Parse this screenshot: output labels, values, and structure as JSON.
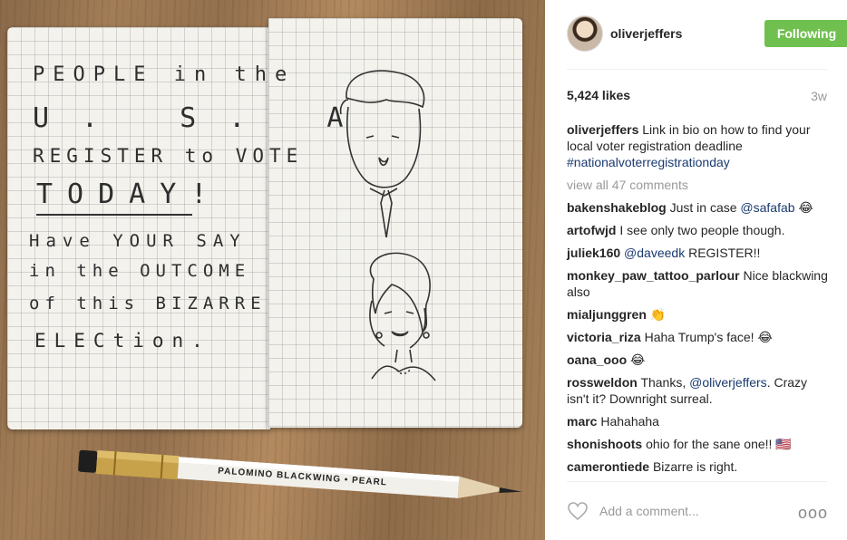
{
  "photo": {
    "notebook_text": [
      "PEOPLE in the",
      "U. S. A",
      "REGISTER to VOTE",
      "TODAY!",
      "Have YOUR SAY",
      "in the OUTCOME",
      "of this BIZARRE",
      "ELECtion."
    ],
    "pencil_text": "PALOMINO BLACKWING • PEARL"
  },
  "header": {
    "username": "oliverjeffers",
    "follow_label": "Following"
  },
  "post": {
    "likes": "5,424 likes",
    "age": "3w"
  },
  "caption": {
    "user": "oliverjeffers",
    "text": "Link in bio on how to find your local voter registration deadline",
    "hashtag": "#nationalvoterregistrationday"
  },
  "view_all": "view all 47 comments",
  "comments": [
    {
      "user": "bakenshakeblog",
      "text": "Just in case",
      "mention": "@safafab",
      "emoji": "😂"
    },
    {
      "user": "artofwjd",
      "text": "I see only two people though."
    },
    {
      "user": "juliek160",
      "mention": "@daveedk",
      "text_after": "REGISTER!!"
    },
    {
      "user": "monkey_paw_tattoo_parlour",
      "text": "Nice blackwing also"
    },
    {
      "user": "mialjunggren",
      "emoji": "👏"
    },
    {
      "user": "victoria_riza",
      "text": "Haha Trump's face!",
      "emoji": "😂"
    },
    {
      "user": "oana_ooo",
      "emoji": "😂"
    },
    {
      "user": "rossweldon",
      "text": "Thanks,",
      "mention": "@oliverjeffers",
      "text_after": ". Crazy isn't it? Downright surreal."
    },
    {
      "user": "marc",
      "text": "Hahahaha"
    },
    {
      "user": "shonishoots",
      "text": "ohio for the sane one!!",
      "emoji": "🇺🇸"
    },
    {
      "user": "camerontiede",
      "text": "Bizarre is right."
    }
  ],
  "footer": {
    "add_comment_placeholder": "Add a comment...",
    "more_label": "ooo"
  },
  "colors": {
    "follow_green": "#70c050",
    "mention_blue": "#1a3a70",
    "muted_gray": "#999999"
  },
  "icons": {
    "like": "heart-outline-icon",
    "more": "more-options-icon"
  }
}
